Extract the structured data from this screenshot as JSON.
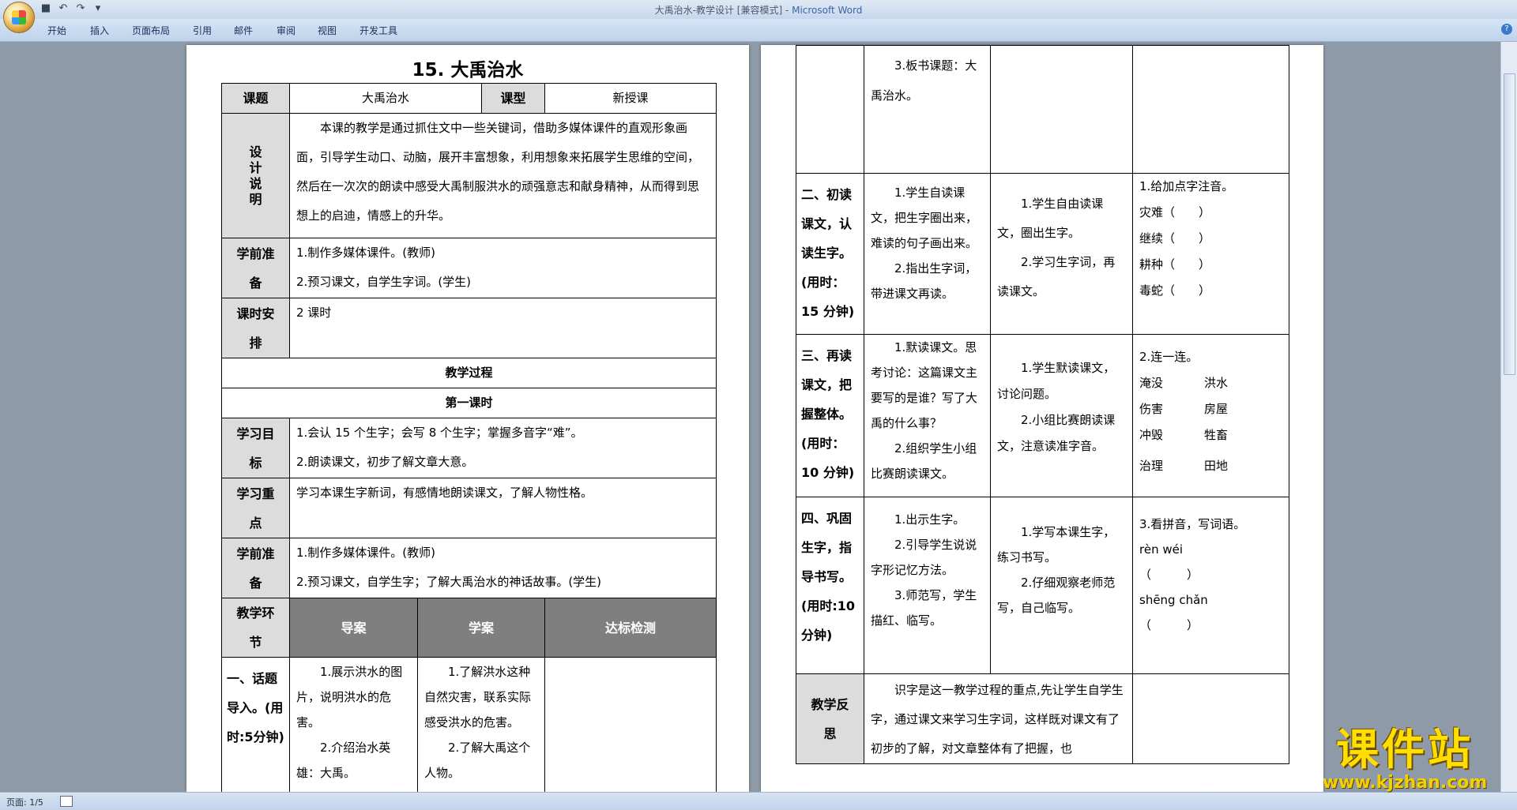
{
  "window": {
    "title": "大禹治水-教学设计 [兼容模式] - ",
    "app_name": "Microsoft Word",
    "qat_icons": [
      "save-icon",
      "undo-icon",
      "redo-icon",
      "customize-icon"
    ]
  },
  "ribbon": {
    "tabs": [
      "开始",
      "插入",
      "页面布局",
      "引用",
      "邮件",
      "审阅",
      "视图",
      "开发工具"
    ]
  },
  "status": {
    "page_label": "页面: 1/5"
  },
  "doc": {
    "title": "15. 大禹治水",
    "row1": {
      "label1": "课题",
      "value1": "大禹治水",
      "label2": "课型",
      "value2": "新授课"
    },
    "design": {
      "label": "设计说明",
      "text": "本课的教学是通过抓住文中一些关键词，借助多媒体课件的直观形象画面，引导学生动口、动脑，展开丰富想象，利用想象来拓展学生思维的空间，然后在一次次的朗读中感受大禹制服洪水的顽强意志和献身精神，从而得到思想上的启迪，情感上的升华。"
    },
    "prep1": {
      "label": "学前准备",
      "line1": "1.制作多媒体课件。(教师)",
      "line2": "2.预习课文，自学生字词。(学生)"
    },
    "schedule": {
      "label": "课时安排",
      "text": "2 课时"
    },
    "process": "教学过程",
    "lesson1": "第一课时",
    "goals": {
      "label": "学习目标",
      "line1": "1.会认 15 个生字；会写 8 个生字；掌握多音字“难”。",
      "line2": "2.朗读课文，初步了解文章大意。"
    },
    "focus": {
      "label": "学习重点",
      "text": "学习本课生字新词，有感情地朗读课文，了解人物性格。"
    },
    "prep2": {
      "label": "学前准备",
      "line1": "1.制作多媒体课件。(教师)",
      "line2": "2.预习课文，自学生字；了解大禹治水的神话故事。(学生)"
    },
    "head": {
      "stage": "教学环节",
      "guide": "导案",
      "study": "学案",
      "check": "达标检测"
    },
    "s1": {
      "stage": "一、话题导入。(用时:5分钟)",
      "guide1": "1.展示洪水的图片，说明洪水的危害。",
      "guide2": "2.介绍治水英雄：大禹。",
      "study1": "1.了解洪水这种自然灾害，联系实际感受洪水的危害。",
      "study2": "2.了解大禹这个人物。",
      "guide3": "3.板书课题：大禹治水。"
    },
    "s2": {
      "stage": "二、初读课文，认读生字。(用时：15 分钟)",
      "guide1": "1.学生自读课文，把生字圈出来，难读的句子画出来。",
      "guide2": "2.指出生字词，带进课文再读。",
      "study1": "1.学生自由读课文，圈出生字。",
      "study2": "2.学习生字词，再读课文。",
      "check_title": "1.给加点字注音。",
      "check_items": [
        "灾难（　　）",
        "继续（　　）",
        "耕种（　　）",
        "毒蛇（　　）"
      ]
    },
    "s3": {
      "stage": "三、再读课文，把握整体。(用时：10 分钟)",
      "guide1": "1.默读课文。思考讨论：这篇课文主要写的是谁？写了大禹的什么事？",
      "guide2": "2.组织学生小组比赛朗读课文。",
      "study1": "1.学生默读课文，讨论问题。",
      "study2": "2.小组比赛朗读课文，注意读准字音。",
      "check_title": "2.连一连。",
      "pairs": [
        [
          "淹没",
          "洪水"
        ],
        [
          "伤害",
          "房屋"
        ],
        [
          "冲毁",
          "牲畜"
        ],
        [
          "治理",
          "田地"
        ]
      ]
    },
    "s4": {
      "stage": "四、巩固生字，指导书写。(用时:10 分钟)",
      "guide1": "1.出示生字。",
      "guide2": "2.引导学生说说字形记忆方法。",
      "guide3": "3.师范写，学生描红、临写。",
      "study1": "1.学写本课生字，练习书写。",
      "study2": "2.仔细观察老师范写，自己临写。",
      "check_title": "3.看拼音，写词语。",
      "py1": "rèn wéi",
      "blank": "（　　　）",
      "py2": "shēng chǎn"
    },
    "reflect": {
      "label": "教学反思",
      "text": "识字是这一教学过程的重点,先让学生自学生字，通过课文来学习生字词，这样既对课文有了初步的了解，对文章整体有了把握，也"
    }
  },
  "watermark": {
    "cn": "课件站",
    "url": "www.kjzhan.com"
  },
  "colors": {
    "ribbon": "#bfd3ec",
    "workspace": "#8f9aa8",
    "table_header": "#7f7f7f",
    "watermark": "#ffde00"
  }
}
